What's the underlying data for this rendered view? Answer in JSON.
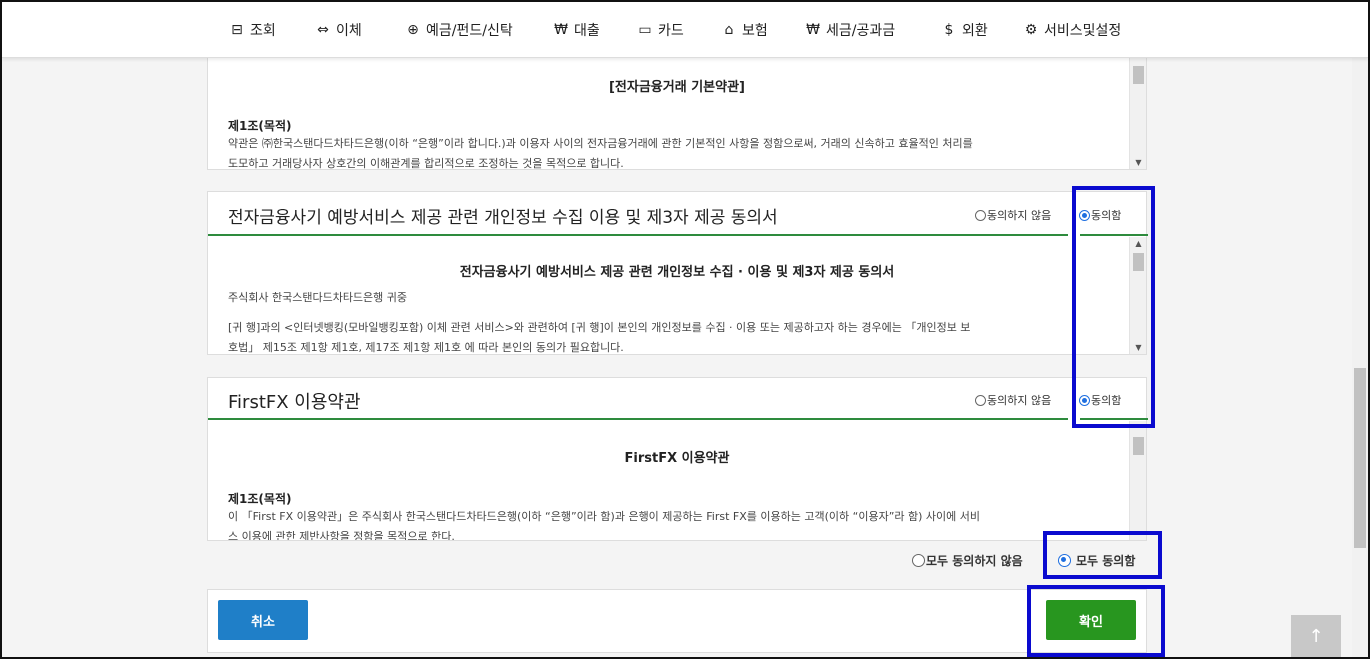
{
  "nav": [
    {
      "icon": "⊟",
      "label": "조회",
      "name": "nav-inquiry"
    },
    {
      "icon": "⇔",
      "label": "이체",
      "name": "nav-transfer"
    },
    {
      "icon": "⊕",
      "label": "예금/펀드/신탁",
      "name": "nav-deposit"
    },
    {
      "icon": "₩",
      "label": "대출",
      "name": "nav-loan"
    },
    {
      "icon": "▭",
      "label": "카드",
      "name": "nav-card"
    },
    {
      "icon": "⌂",
      "label": "보험",
      "name": "nav-insurance"
    },
    {
      "icon": "₩",
      "label": "세금/공과금",
      "name": "nav-tax"
    },
    {
      "icon": "$",
      "label": "외환",
      "name": "nav-fx"
    },
    {
      "icon": "⚙",
      "label": "서비스및설정",
      "name": "nav-settings"
    }
  ],
  "terms1": {
    "heading": "[전자금융거래 기본약관]",
    "article": "제1조(목적)",
    "text1": "약관은 ㈜한국스탠다드차타드은행(이하 “은행”이라 합니다.)과 이용자 사이의 전자금융거래에 관한 기본적인 사항을 정함으로써, 거래의 신속하고 효율적인 처리를",
    "text2": "도모하고 거래당사자 상호간의 이해관계를 합리적으로 조정하는 것을 목적으로 합니다."
  },
  "section2": {
    "title": "전자금융사기 예방서비스 제공 관련 개인정보 수집 이용 및 제3자 제공 동의서",
    "disagree": "동의하지 않음",
    "agree": "동의함",
    "heading": "전자금융사기 예방서비스 제공 관련 개인정보 수집 · 이용 및 제3자 제공 동의서",
    "to": "주식회사 한국스탠다드차타드은행 귀중",
    "text1": "[귀 행]과의 <인터넷뱅킹(모바일뱅킹포함) 이체 관련 서비스>와 관련하여 [귀 행]이 본인의 개인정보를 수집 · 이용 또는 제공하고자 하는 경우에는 「개인정보 보",
    "text2": "호법」 제15조 제1항 제1호, 제17조 제1항 제1호 에 따라 본인의 동의가 필요합니다."
  },
  "section3": {
    "title": "FirstFX 이용약관",
    "disagree": "동의하지 않음",
    "agree": "동의함",
    "heading": "FirstFX 이용약관",
    "article": "제1조(목적)",
    "text1": "이 「First FX 이용약관」은 주식회사 한국스탠다드차타드은행(이하 “은행”이라 함)과 은행이 제공하는 First FX를 이용하는 고객(이하 “이용자”라 함) 사이에 서비",
    "text2": "스 이용에 관한 제반사항을 정함을 목적으로 한다."
  },
  "all": {
    "disagree": "모두 동의하지 않음",
    "agree": "모두 동의함"
  },
  "buttons": {
    "cancel": "취소",
    "confirm": "확인",
    "top": "↑"
  },
  "colors": {
    "accent_green": "#2e8b3d",
    "cancel_blue": "#1f7fc8",
    "confirm_green": "#28961f",
    "highlight": "#0a0acf"
  }
}
